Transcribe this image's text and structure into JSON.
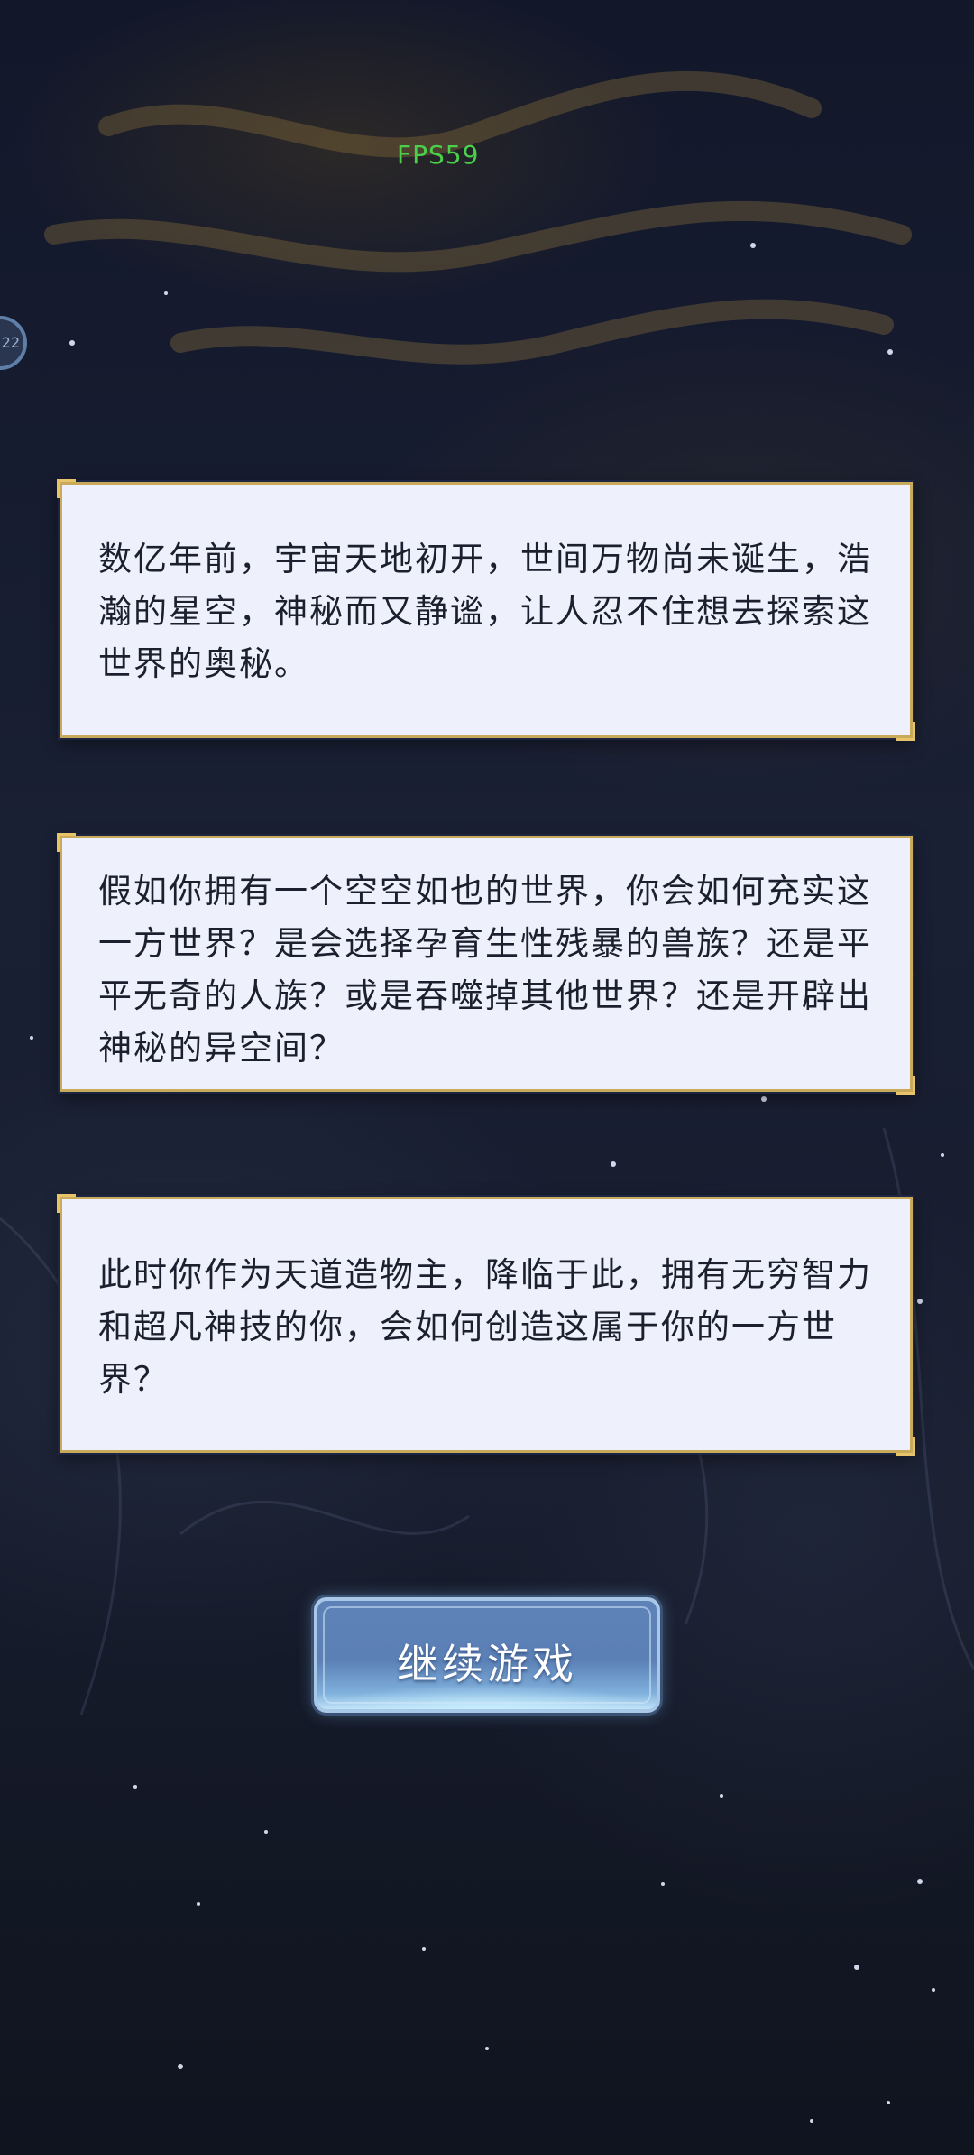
{
  "hud": {
    "fps_label": "FPS59",
    "side_badge_text": "22"
  },
  "story": {
    "paragraphs": [
      "数亿年前，宇宙天地初开，世间万物尚未诞生，浩瀚的星空，神秘而又静谧，让人忍不住想去探索这世界的奥秘。",
      "假如你拥有一个空空如也的世界，你会如何充实这一方世界？是会选择孕育生性残暴的兽族？还是平平无奇的人族？或是吞噬掉其他世界？还是开辟出神秘的异空间？",
      "此时你作为天道造物主，降临于此，拥有无穷智力和超凡神技的你，会如何创造这属于你的一方世界？"
    ]
  },
  "actions": {
    "continue_label": "继续游戏"
  },
  "colors": {
    "panel_bg": "#eef0fb",
    "panel_border": "#c9a95a",
    "button_blue": "#5e82b8",
    "fps_green": "#4ad04a"
  }
}
